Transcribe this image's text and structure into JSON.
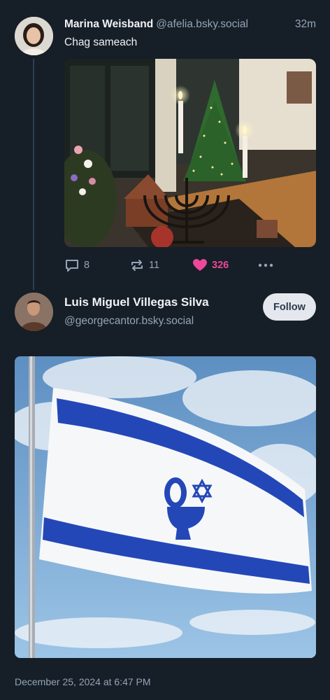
{
  "post1": {
    "author_name": "Marina Weisband",
    "author_handle": "@afelia.bsky.social",
    "time_ago": "32m",
    "text": "Chag sameach",
    "reply_count": "8",
    "repost_count": "11",
    "like_count": "326",
    "liked": true,
    "image_icon": "hanukkah-menorah-christmas-tree-photo"
  },
  "post2": {
    "author_name": "Luis Miguel Villegas Silva",
    "author_handle": "@georgecantor.bsky.social",
    "follow_label": "Follow",
    "image_icon": "israeli-flag-with-toilet-symbol",
    "timestamp": "December 25, 2024 at 6:47 PM"
  },
  "colors": {
    "background": "#161e27",
    "secondary_text": "#93a5b7",
    "like_accent": "#ec4899",
    "thread_line": "#2e4052",
    "follow_button_bg": "#e4e8ee"
  }
}
